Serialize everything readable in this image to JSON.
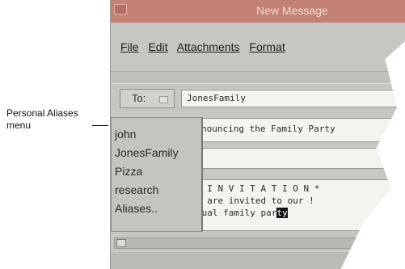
{
  "callout": {
    "label": "Personal Aliases menu"
  },
  "window": {
    "title": "New Message",
    "menus": [
      "File",
      "Edit",
      "Attachments",
      "Format"
    ],
    "to_button": "To:",
    "to_value": "JonesFamily",
    "subject_value": "nouncing the Family Party",
    "body_lines": [
      "* I N V I T A T I O N *",
      "u are invited to our !",
      "nual family par"
    ],
    "cursor_text": "ty"
  },
  "aliases_menu": {
    "items": [
      "john",
      "JonesFamily",
      "Pizza",
      "research",
      "Aliases.."
    ]
  }
}
